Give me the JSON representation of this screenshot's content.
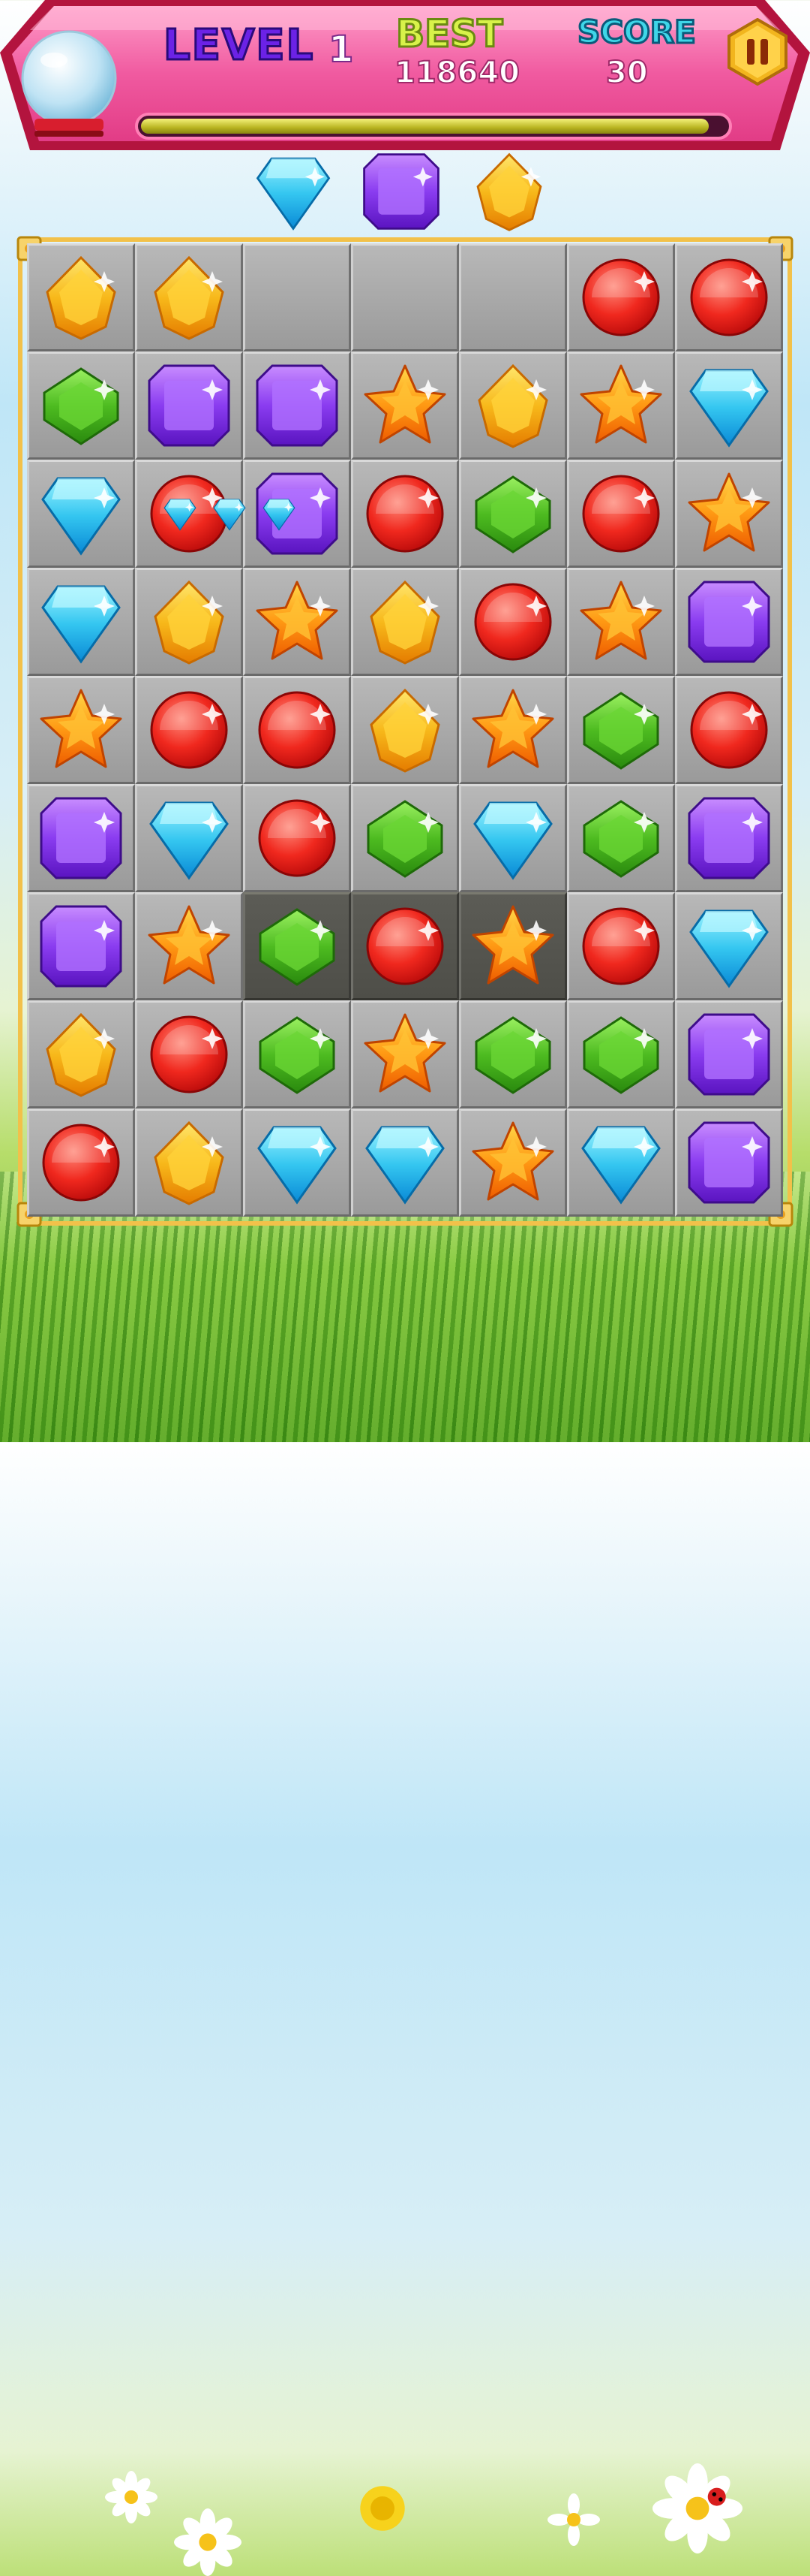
{
  "hud": {
    "level_label": "LEVEL",
    "level_value": "1",
    "best_label": "BEST",
    "best_value": "118640",
    "score_label": "SCORE",
    "score_value": "30",
    "progress": 0.97
  },
  "icons": {
    "pause": "pause-icon",
    "globe": "snow-globe-icon"
  },
  "colors": {
    "banner_pink": "#f05aa0",
    "banner_border": "#c0224a",
    "progress_fill": "#c9c42a",
    "board_frame": "#f2c14a"
  },
  "preview_gems": [
    "blue",
    "purple",
    "yellow"
  ],
  "board": {
    "columns": 7,
    "rows": 9,
    "cells": [
      [
        "yellow",
        "yellow",
        "empty",
        "empty",
        "empty",
        "red",
        "red"
      ],
      [
        "green",
        "purple",
        "purple",
        "star",
        "yellow",
        "star",
        "blue"
      ],
      [
        "blue",
        "red",
        "purple",
        "red",
        "green",
        "red",
        "star"
      ],
      [
        "blue",
        "yellow",
        "star",
        "yellow",
        "red",
        "star",
        "purple"
      ],
      [
        "star",
        "red",
        "red",
        "yellow",
        "star",
        "green",
        "red"
      ],
      [
        "purple",
        "blue",
        "red",
        "green",
        "blue",
        "green",
        "purple"
      ],
      [
        "purple",
        "star",
        "green",
        "red",
        "star",
        "red",
        "blue"
      ],
      [
        "yellow",
        "red",
        "green",
        "star",
        "green",
        "green",
        "purple"
      ],
      [
        "red",
        "yellow",
        "blue",
        "blue",
        "star",
        "blue",
        "purple"
      ]
    ],
    "dark_cells": [
      [
        6,
        2
      ],
      [
        6,
        3
      ],
      [
        6,
        4
      ]
    ]
  }
}
